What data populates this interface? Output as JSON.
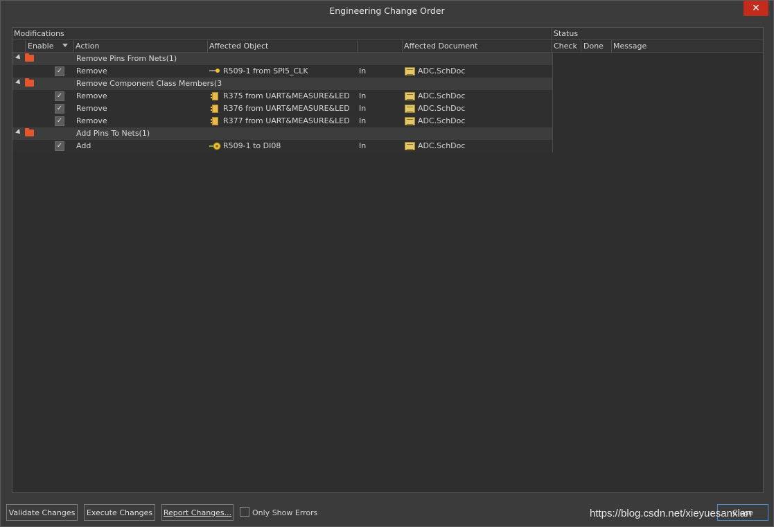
{
  "window": {
    "title": "Engineering Change Order",
    "close_label": "✕"
  },
  "header": {
    "modifications": "Modifications",
    "status": "Status",
    "enable": "Enable",
    "action": "Action",
    "affected_object": "Affected Object",
    "affected_document": "Affected Document",
    "check": "Check",
    "done": "Done",
    "message": "Message"
  },
  "rows": [
    {
      "type": "group",
      "label": "Remove Pins From Nets(1)"
    },
    {
      "type": "item",
      "action": "Remove",
      "object": "R509-1 from SPI5_CLK",
      "direction": "In",
      "document": "ADC.SchDoc",
      "icon": "pin-icon",
      "checked": true
    },
    {
      "type": "group",
      "label": "Remove Component Class Members(3"
    },
    {
      "type": "item",
      "action": "Remove",
      "object": "R375 from UART&MEASURE&LED",
      "direction": "In",
      "document": "ADC.SchDoc",
      "icon": "component-icon",
      "checked": true
    },
    {
      "type": "item",
      "action": "Remove",
      "object": "R376 from UART&MEASURE&LED",
      "direction": "In",
      "document": "ADC.SchDoc",
      "icon": "component-icon",
      "checked": true
    },
    {
      "type": "item",
      "action": "Remove",
      "object": "R377 from UART&MEASURE&LED",
      "direction": "In",
      "document": "ADC.SchDoc",
      "icon": "component-icon",
      "checked": true
    },
    {
      "type": "group",
      "label": "Add Pins To Nets(1)"
    },
    {
      "type": "item",
      "action": "Add",
      "object": "R509-1 to DI08",
      "direction": "In",
      "document": "ADC.SchDoc",
      "icon": "add-pin-icon",
      "checked": true
    }
  ],
  "footer": {
    "validate": "Validate Changes",
    "execute": "Execute Changes",
    "report": "Report Changes...",
    "only_errors": "Only Show Errors",
    "close": "Close"
  },
  "watermark": "https://blog.csdn.net/xieyuesanxian",
  "colors": {
    "accent_close": "#c42b1c",
    "folder": "#e5562c",
    "doc_icon": "#e4c86e"
  }
}
